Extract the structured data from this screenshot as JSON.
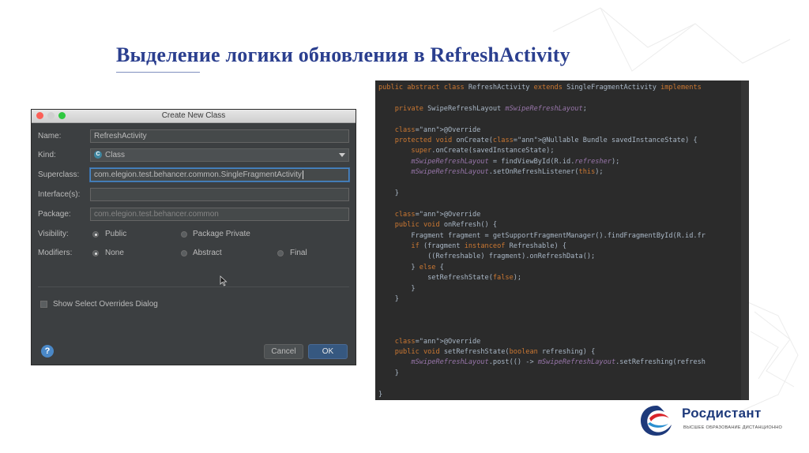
{
  "slide": {
    "title": "Выделение логики обновления в RefreshActivity"
  },
  "dialog": {
    "title": "Create New Class",
    "labels": {
      "name": "Name:",
      "kind": "Kind:",
      "superclass": "Superclass:",
      "interfaces": "Interface(s):",
      "package": "Package:",
      "visibility": "Visibility:",
      "modifiers": "Modifiers:"
    },
    "fields": {
      "name": "RefreshActivity",
      "kind": "Class",
      "superclass": "com.elegion.test.behancer.common.SingleFragmentActivity",
      "interfaces": "",
      "package": "com.elegion.test.behancer.common"
    },
    "visibility_options": [
      "Public",
      "Package Private"
    ],
    "visibility_selected": "Public",
    "modifier_options": [
      "None",
      "Abstract",
      "Final"
    ],
    "modifier_selected": "None",
    "show_overrides_label": "Show Select Overrides Dialog",
    "show_overrides_checked": false,
    "help_label": "?",
    "cancel_label": "Cancel",
    "ok_label": "OK"
  },
  "code": {
    "lines": [
      "public abstract class RefreshActivity extends SingleFragmentActivity implements",
      "",
      "    private SwipeRefreshLayout mSwipeRefreshLayout;",
      "",
      "    @Override",
      "    protected void onCreate(@Nullable Bundle savedInstanceState) {",
      "        super.onCreate(savedInstanceState);",
      "        mSwipeRefreshLayout = findViewById(R.id.refresher);",
      "        mSwipeRefreshLayout.setOnRefreshListener(this);",
      "",
      "    }",
      "",
      "    @Override",
      "    public void onRefresh() {",
      "        Fragment fragment = getSupportFragmentManager().findFragmentById(R.id.fr",
      "        if (fragment instanceof Refreshable) {",
      "            ((Refreshable) fragment).onRefreshData();",
      "        } else {",
      "            setRefreshState(false);",
      "        }",
      "    }",
      "",
      "",
      "",
      "    @Override",
      "    public void setRefreshState(boolean refreshing) {",
      "        mSwipeRefreshLayout.post(() -> mSwipeRefreshLayout.setRefreshing(refresh",
      "    }",
      "",
      "}"
    ]
  },
  "logo": {
    "name": "Росдистант",
    "tagline": "ВЫСШЕЕ ОБРАЗОВАНИЕ ДИСТАНЦИОННО"
  },
  "colors": {
    "title": "#2b3f8f",
    "dialog_bg": "#3c3f41",
    "code_bg": "#2b2b2b",
    "keyword": "#cc7832",
    "annotation": "#bbb529",
    "field": "#9876aa",
    "focus_accent": "#4a88c7",
    "brand": "#1e3a7b"
  }
}
